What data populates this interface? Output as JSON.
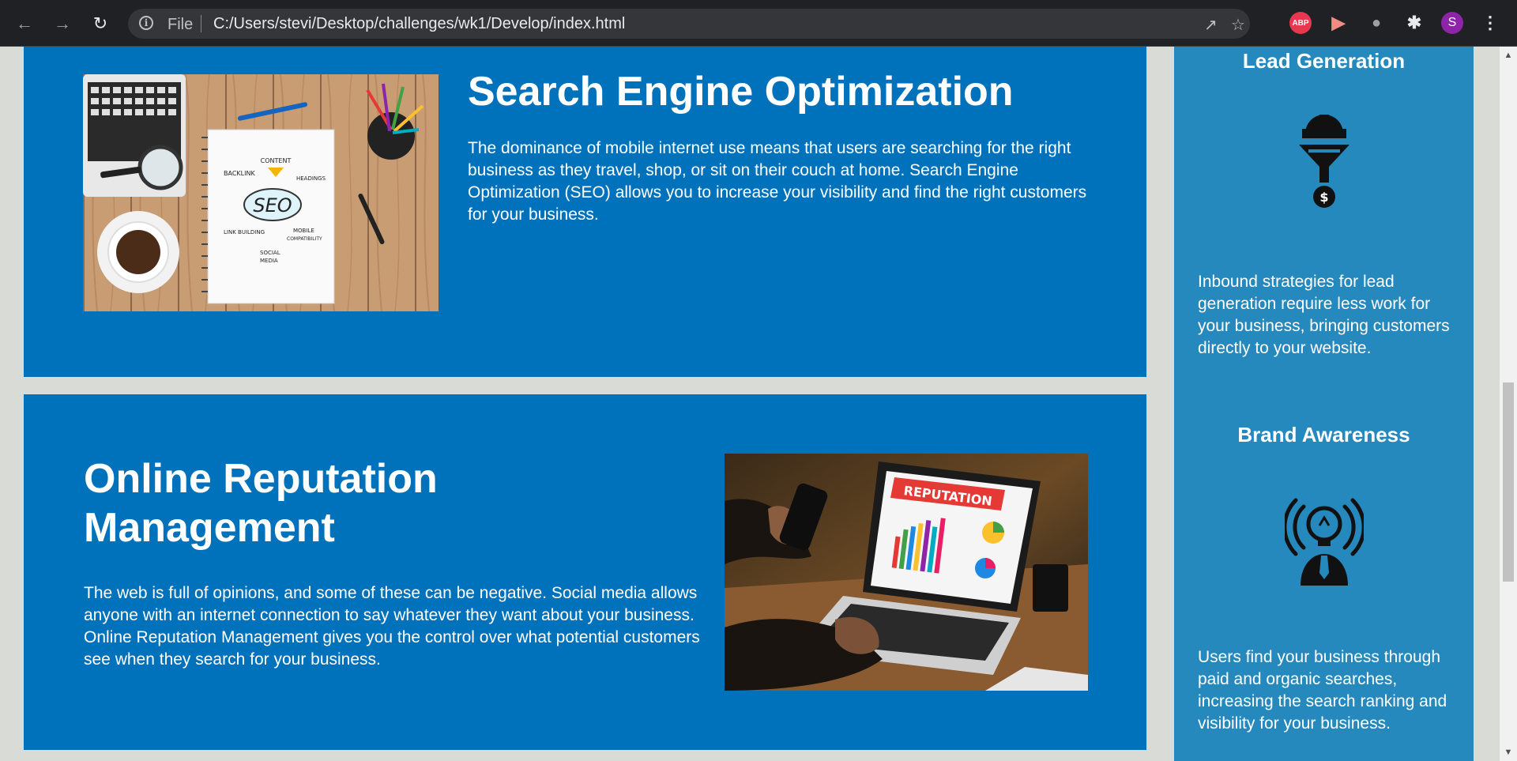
{
  "browser": {
    "file_label": "File",
    "url": "C:/Users/stevi/Desktop/challenges/wk1/Develop/index.html",
    "extensions": {
      "adblock_label": "ABP",
      "profile_initial": "S"
    }
  },
  "main": {
    "seo": {
      "title": "Search Engine Optimization",
      "text": "The dominance of mobile internet use means that users are searching for the right business as they travel, shop, or sit on their couch at home. Search Engine Optimization (SEO) allows you to increase your visibility and find the right customers for your business.",
      "image_words": [
        "CONTENT",
        "BACKLINK",
        "HEADINGS",
        "SEO",
        "LINK BUILDING",
        "MOBILE COMPATIBILITY",
        "SOCIAL MEDIA"
      ]
    },
    "orm": {
      "title": "Online Reputation Management",
      "text": "The web is full of opinions, and some of these can be negative. Social media allows anyone with an internet connection to say whatever they want about your business. Online Reputation Management gives you the control over what potential customers see when they search for your business.",
      "image_banner": "REPUTATION"
    }
  },
  "sidebar": {
    "lead": {
      "title": "Lead Generation",
      "text": "Inbound strategies for lead generation require less work for your business, bringing customers directly to your website."
    },
    "brand": {
      "title": "Brand Awareness",
      "text": "Users find your business through paid and organic searches, increasing the search ranking and visibility for your business."
    }
  },
  "colors": {
    "card_bg": "#0072bb",
    "sidebar_bg": "#2589bd",
    "page_bg": "#d9dcd6"
  }
}
